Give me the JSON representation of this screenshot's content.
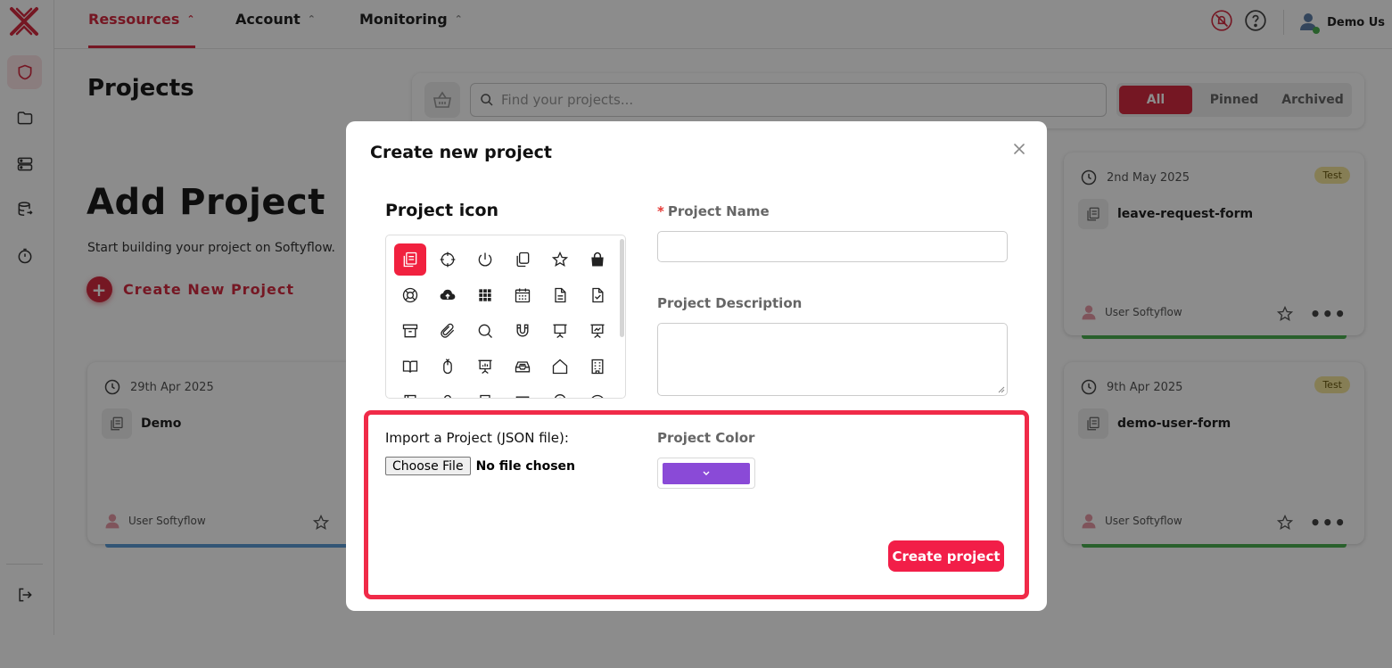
{
  "nav": {
    "tabs": [
      {
        "label": "Ressources"
      },
      {
        "label": "Account"
      },
      {
        "label": "Monitoring"
      }
    ],
    "user_name": "Demo Us"
  },
  "sidebar": {
    "items": [
      "shield-icon",
      "folder-icon",
      "server-icon",
      "database-export-icon",
      "timer-icon"
    ],
    "logout_icon": "logout-icon"
  },
  "page": {
    "title": "Projects",
    "add_title": "Add Project",
    "add_subtitle": "Start building your project on Softyflow.",
    "create_link": "Create New Project"
  },
  "filter": {
    "search_placeholder": "Find your projects...",
    "segments": [
      "All",
      "Pinned",
      "Archived"
    ],
    "active_segment": "All"
  },
  "cards": [
    {
      "date": "2nd May 2025",
      "badge": "Test",
      "title": "leave-request-form",
      "user": "User Softyflow",
      "bar_color": "#4caf50"
    },
    {
      "date": "29th Apr 2025",
      "badge": "",
      "title": "Demo",
      "user": "User Softyflow",
      "bar_color": "#5b9bd5"
    },
    {
      "date": "9th Apr 2025",
      "badge": "Test",
      "title": "demo-user-form",
      "user": "User Softyflow",
      "bar_color": "#4caf50"
    }
  ],
  "modal": {
    "title": "Create new project",
    "icon_section_title": "Project icon",
    "project_name_required_mark": "*",
    "project_name_label": "Project Name",
    "project_name_value": "",
    "project_description_label": "Project Description",
    "project_description_value": "",
    "import_label": "Import a Project (JSON file):",
    "file_button_label": "Choose File",
    "file_status": "No file chosen",
    "project_color_label": "Project Color",
    "project_color_value": "#8a4ad7",
    "create_button_label": "Create project",
    "icons": [
      "documents-icon",
      "crosshair-icon",
      "power-icon",
      "copy-icon",
      "star-icon",
      "shopping-bag-icon",
      "lifebuoy-icon",
      "cloud-upload-icon",
      "grid-icon",
      "calendar-icon",
      "file-text-icon",
      "file-check-icon",
      "archive-icon",
      "paperclip-icon",
      "search-icon",
      "magnet-icon",
      "presentation-icon",
      "presentation-chart-icon",
      "book-open-icon",
      "mouse-icon",
      "chart-board-icon",
      "inbox-icon",
      "home-icon",
      "building-icon",
      "book-icon",
      "user-icon",
      "bookmark-icon",
      "message-icon",
      "pin-icon",
      "compass-icon"
    ],
    "selected_icon": "documents-icon"
  },
  "colors": {
    "brand": "#d62b40",
    "highlight": "#f02a48",
    "create_button": "#f21e48"
  }
}
